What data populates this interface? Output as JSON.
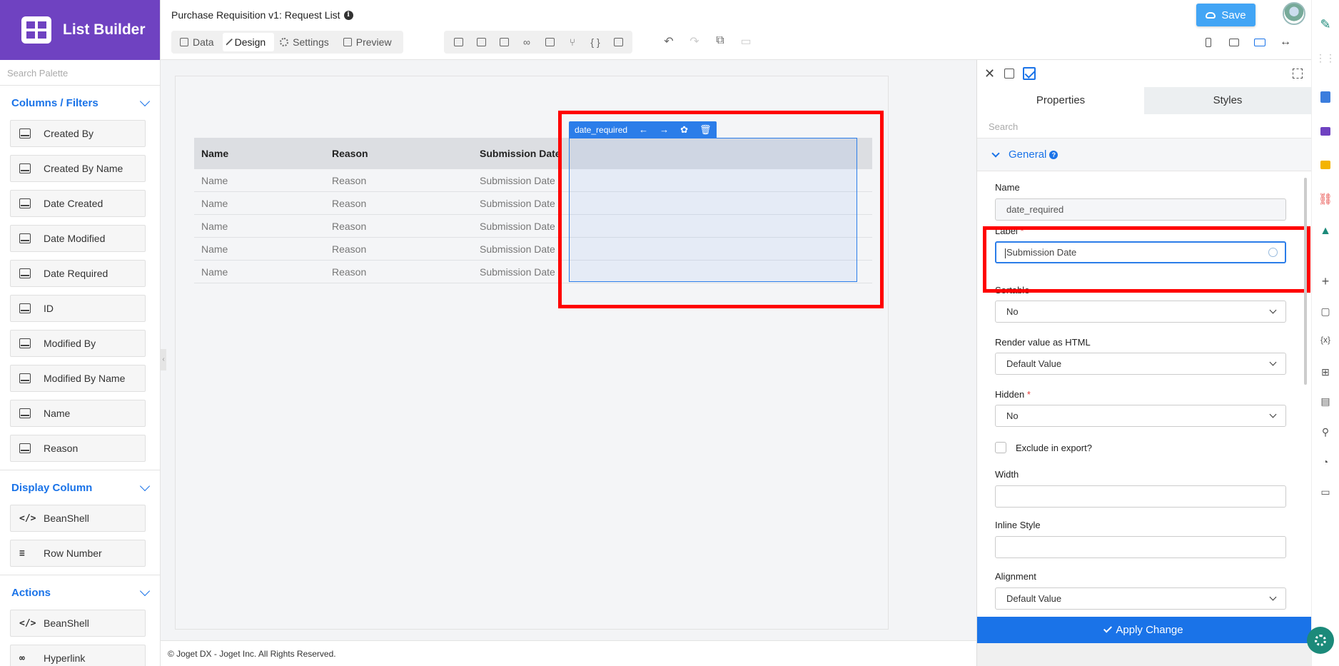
{
  "app": {
    "title": "List Builder"
  },
  "palette": {
    "search_placeholder": "Search Palette",
    "sections": [
      {
        "title": "Columns / Filters",
        "items": [
          "Created By",
          "Created By Name",
          "Date Created",
          "Date Modified",
          "Date Required",
          "ID",
          "Modified By",
          "Modified By Name",
          "Name",
          "Reason"
        ]
      },
      {
        "title": "Display Column",
        "items": [
          "BeanShell",
          "Row Number"
        ]
      },
      {
        "title": "Actions",
        "items": [
          "BeanShell",
          "Hyperlink"
        ]
      }
    ]
  },
  "header": {
    "doc_title": "Purchase Requisition v1: Request List",
    "modes": [
      "Data",
      "Design",
      "Settings",
      "Preview"
    ],
    "active_mode": "Design",
    "save_label": "Save"
  },
  "canvas": {
    "selected_column_id": "date_required",
    "columns": [
      "Name",
      "Reason",
      "Submission Date"
    ],
    "rows": [
      [
        "Name",
        "Reason",
        "Submission Date"
      ],
      [
        "Name",
        "Reason",
        "Submission Date"
      ],
      [
        "Name",
        "Reason",
        "Submission Date"
      ],
      [
        "Name",
        "Reason",
        "Submission Date"
      ],
      [
        "Name",
        "Reason",
        "Submission Date"
      ]
    ]
  },
  "footer": {
    "text": "© Joget DX - Joget Inc. All Rights Reserved."
  },
  "properties": {
    "tabs": [
      "Properties",
      "Styles"
    ],
    "active_tab": "Properties",
    "search_placeholder": "Search",
    "section_title": "General",
    "fields": {
      "name": {
        "label": "Name",
        "value": "date_required"
      },
      "label": {
        "label": "Label",
        "value": "Submission Date",
        "required": "*"
      },
      "sortable": {
        "label": "Sortable",
        "value": "No"
      },
      "render_html": {
        "label": "Render value as HTML",
        "value": "Default Value"
      },
      "hidden": {
        "label": "Hidden",
        "value": "No",
        "required": "*"
      },
      "exclude_export": {
        "label": "Exclude in export?"
      },
      "width": {
        "label": "Width",
        "value": ""
      },
      "inline_style": {
        "label": "Inline Style",
        "value": ""
      },
      "alignment": {
        "label": "Alignment",
        "value": "Default Value"
      }
    },
    "apply_label": "Apply Change"
  },
  "colors": {
    "brand": "#6f42c1",
    "accent": "#1a73e8",
    "highlight": "#ff0000"
  }
}
